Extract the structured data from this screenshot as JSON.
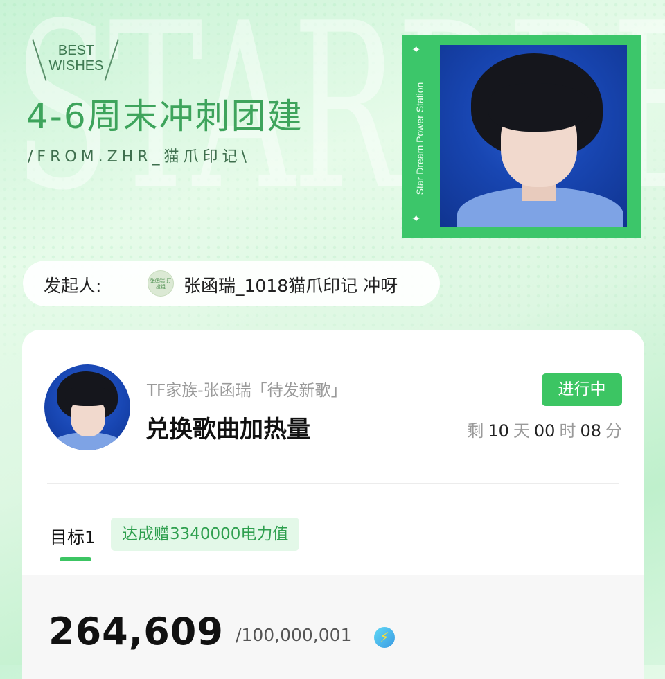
{
  "header": {
    "badge_text": "BEST\nWISHES",
    "background_word": "STARDREAM",
    "title": "4-6周末冲刺团建",
    "subtitle": "/FROM.ZHR_猫爪印记\\"
  },
  "poster": {
    "vertical_text": "Star Dream Power Station",
    "star_glyph": "✦"
  },
  "initiator": {
    "label": "发起人:",
    "avatar_text": "张函瑞 打投组",
    "name": "张函瑞_1018猫爪印记 冲呀"
  },
  "task_card": {
    "fandom": "TF家族-张函瑞「待发新歌」",
    "task_title": "兑换歌曲加热量",
    "status": "进行中",
    "countdown": {
      "prefix": "剩",
      "days": "10",
      "days_unit": "天",
      "hours": "00",
      "hours_unit": "时",
      "minutes": "08",
      "minutes_unit": "分"
    },
    "goal_tab": "目标1",
    "goal_reward": "达成赠3340000电力值",
    "current_value": "264,609",
    "total_value": "/100,000,001",
    "bolt_icon": "⚡"
  },
  "colors": {
    "accent_green": "#3cc563",
    "title_green": "#3ea45c",
    "poster_blue": "#1846b2"
  }
}
